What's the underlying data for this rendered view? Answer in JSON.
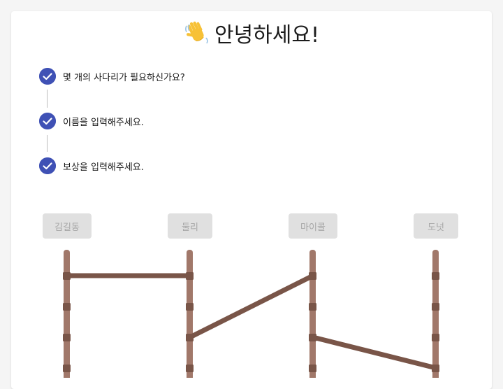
{
  "header": {
    "title": "안녕하세요!",
    "wave_icon": "waving-hand-icon"
  },
  "steps": [
    {
      "label": "몇 개의 사다리가 필요하신가요?",
      "done": true,
      "icon": "check-circle-icon"
    },
    {
      "label": "이름을 입력해주세요.",
      "done": true,
      "icon": "check-circle-icon"
    },
    {
      "label": "보상을 입력해주세요.",
      "done": true,
      "icon": "check-circle-icon"
    }
  ],
  "ladder": {
    "players": [
      "김길동",
      "둘리",
      "마이콜",
      "도넛"
    ],
    "rung_rows": 4,
    "bridges": [
      {
        "from_column": 1,
        "from_row": 1,
        "to_column": 2,
        "to_row": 1
      },
      {
        "from_column": 2,
        "from_row": 3,
        "to_column": 3,
        "to_row": 1
      },
      {
        "from_column": 3,
        "from_row": 3,
        "to_column": 4,
        "to_row": 4
      }
    ]
  },
  "colors": {
    "accent": "#3f51b5",
    "rail": "#a1786a",
    "rung": "#795548",
    "chip_bg": "#e0e0e0",
    "chip_text": "#a6a6a6"
  }
}
